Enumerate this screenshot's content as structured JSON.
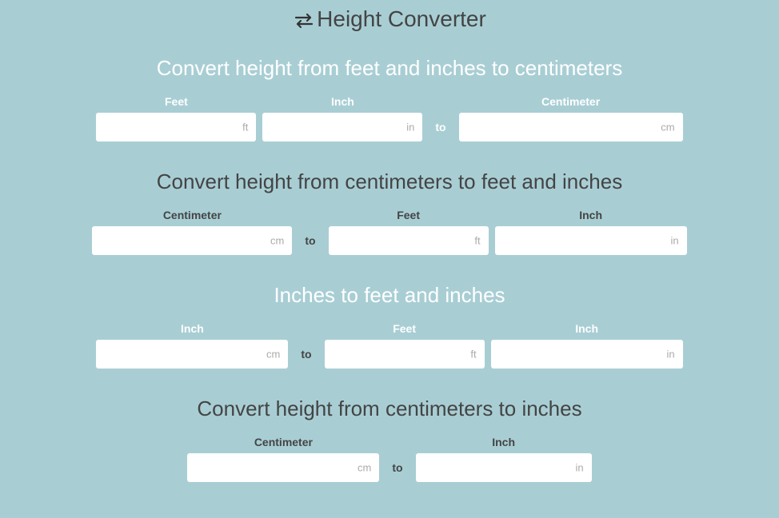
{
  "header": {
    "title": "Height Converter"
  },
  "to_label": "to",
  "sections": {
    "ft_in_to_cm": {
      "title": "Convert height from feet and inches to centimeters",
      "feet_label": "Feet",
      "feet_unit": "ft",
      "feet_value": "",
      "inch_label": "Inch",
      "inch_unit": "in",
      "inch_value": "",
      "cm_label": "Centimeter",
      "cm_unit": "cm",
      "cm_value": ""
    },
    "cm_to_ft_in": {
      "title": "Convert height from centimeters to feet and inches",
      "cm_label": "Centimeter",
      "cm_unit": "cm",
      "cm_value": "",
      "feet_label": "Feet",
      "feet_unit": "ft",
      "feet_value": "",
      "inch_label": "Inch",
      "inch_unit": "in",
      "inch_value": ""
    },
    "in_to_ft_in": {
      "title": "Inches to feet and inches",
      "in_label": "Inch",
      "in_unit": "cm",
      "in_value": "",
      "feet_label": "Feet",
      "feet_unit": "ft",
      "feet_value": "",
      "inch_label": "Inch",
      "inch_unit": "in",
      "inch_value": ""
    },
    "cm_to_in": {
      "title": "Convert height from centimeters to inches",
      "cm_label": "Centimeter",
      "cm_unit": "cm",
      "cm_value": "",
      "inch_label": "Inch",
      "inch_unit": "in",
      "inch_value": ""
    }
  }
}
